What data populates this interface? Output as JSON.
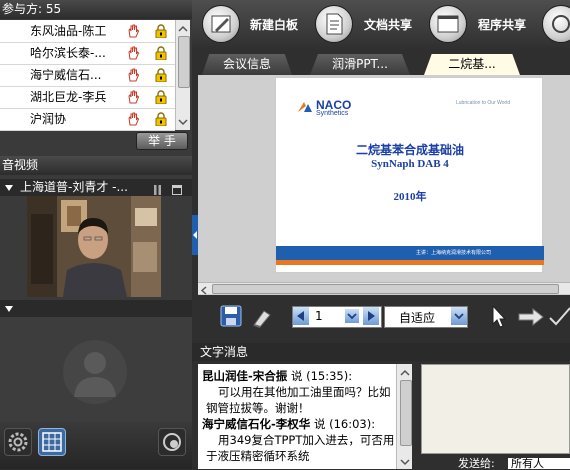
{
  "participants": {
    "title": "参与方: 55",
    "rows": [
      {
        "name": "东风油品-陈工"
      },
      {
        "name": "哈尔滨长泰-..."
      },
      {
        "name": "海宁威信石..."
      },
      {
        "name": "湖北巨龙-李兵"
      },
      {
        "name": "沪润协"
      }
    ],
    "raise_hand_label": "举 手"
  },
  "av": {
    "title": "音视频",
    "speaker": "上海道普-刘青才 -..."
  },
  "toolbar": {
    "whiteboard_label": "新建白板",
    "docshare_label": "文档共享",
    "appshare_label": "程序共享"
  },
  "tabs": [
    {
      "label": "会议信息"
    },
    {
      "label": "润滑PPT..."
    },
    {
      "label": "二烷基..."
    }
  ],
  "slide": {
    "logo_top": "NACO",
    "logo_bottom": "Synthetics",
    "tagline": "Lubrication to Our World",
    "title": "二烷基苯合成基础油",
    "subtitle": "SynNaph DAB 4",
    "year": "2010年",
    "footer": "主讲：上海纳克润滑技术有限公司"
  },
  "nav": {
    "page_value": "1",
    "zoom_value": "自适应"
  },
  "chat": {
    "section_title": "文字消息",
    "messages": [
      {
        "sender": "昆山润佳-宋合振",
        "says": "说",
        "time": "(15:35):",
        "text": "可以用在其他加工油里面吗？比如钢管拉拔等。谢谢！"
      },
      {
        "sender": "海宁威信石化-李权华",
        "says": "说",
        "time": "(16:03):",
        "text": "用349复合TPPT加入进去，可否用于液压精密循环系统"
      }
    ],
    "send_to_label": "发送给:",
    "send_to_value": "所有人"
  },
  "colors": {
    "accent_blue": "#1f5fb0",
    "slide_title_blue": "#1a3fa6",
    "slide_bar_orange": "#e87722",
    "hand_red": "#c83c2a",
    "lock_yellow": "#f2c200"
  }
}
